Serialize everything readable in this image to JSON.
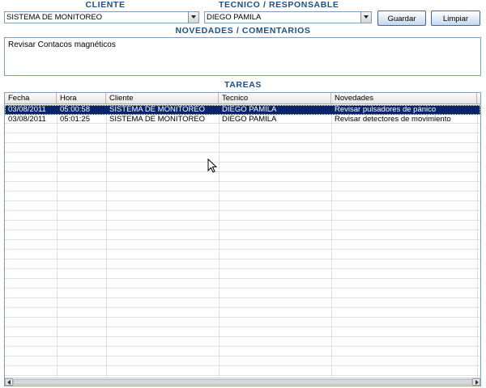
{
  "labels": {
    "cliente": "CLIENTE",
    "tecnico": "TECNICO / RESPONSABLE",
    "novedades": "NOVEDADES / COMENTARIOS",
    "tareas": "TAREAS"
  },
  "cliente_select": {
    "value": "SISTEMA DE MONITOREO"
  },
  "tecnico_select": {
    "value": "DIEGO PAMILA"
  },
  "buttons": {
    "guardar": "Guardar",
    "limpiar": "Limpiar"
  },
  "novedades_text": "Revisar Contacos magnéticos",
  "table": {
    "columns": [
      "Fecha",
      "Hora",
      "Cliente",
      "Tecnico",
      "Novedades"
    ],
    "rows": [
      [
        "03/08/2011",
        "05:00:58",
        "SISTEMA DE MONITOREO",
        "DIEGO PAMILA",
        "Revisar pulsadores de pánico"
      ],
      [
        "03/08/2011",
        "05:01:25",
        "SISTEMA DE MONITOREO",
        "DIEGO PAMILA",
        "Revisar detectores de movimiento"
      ]
    ],
    "selected_row": 0
  },
  "colors": {
    "label": "#1f4e86",
    "selection": "#0a246a"
  }
}
